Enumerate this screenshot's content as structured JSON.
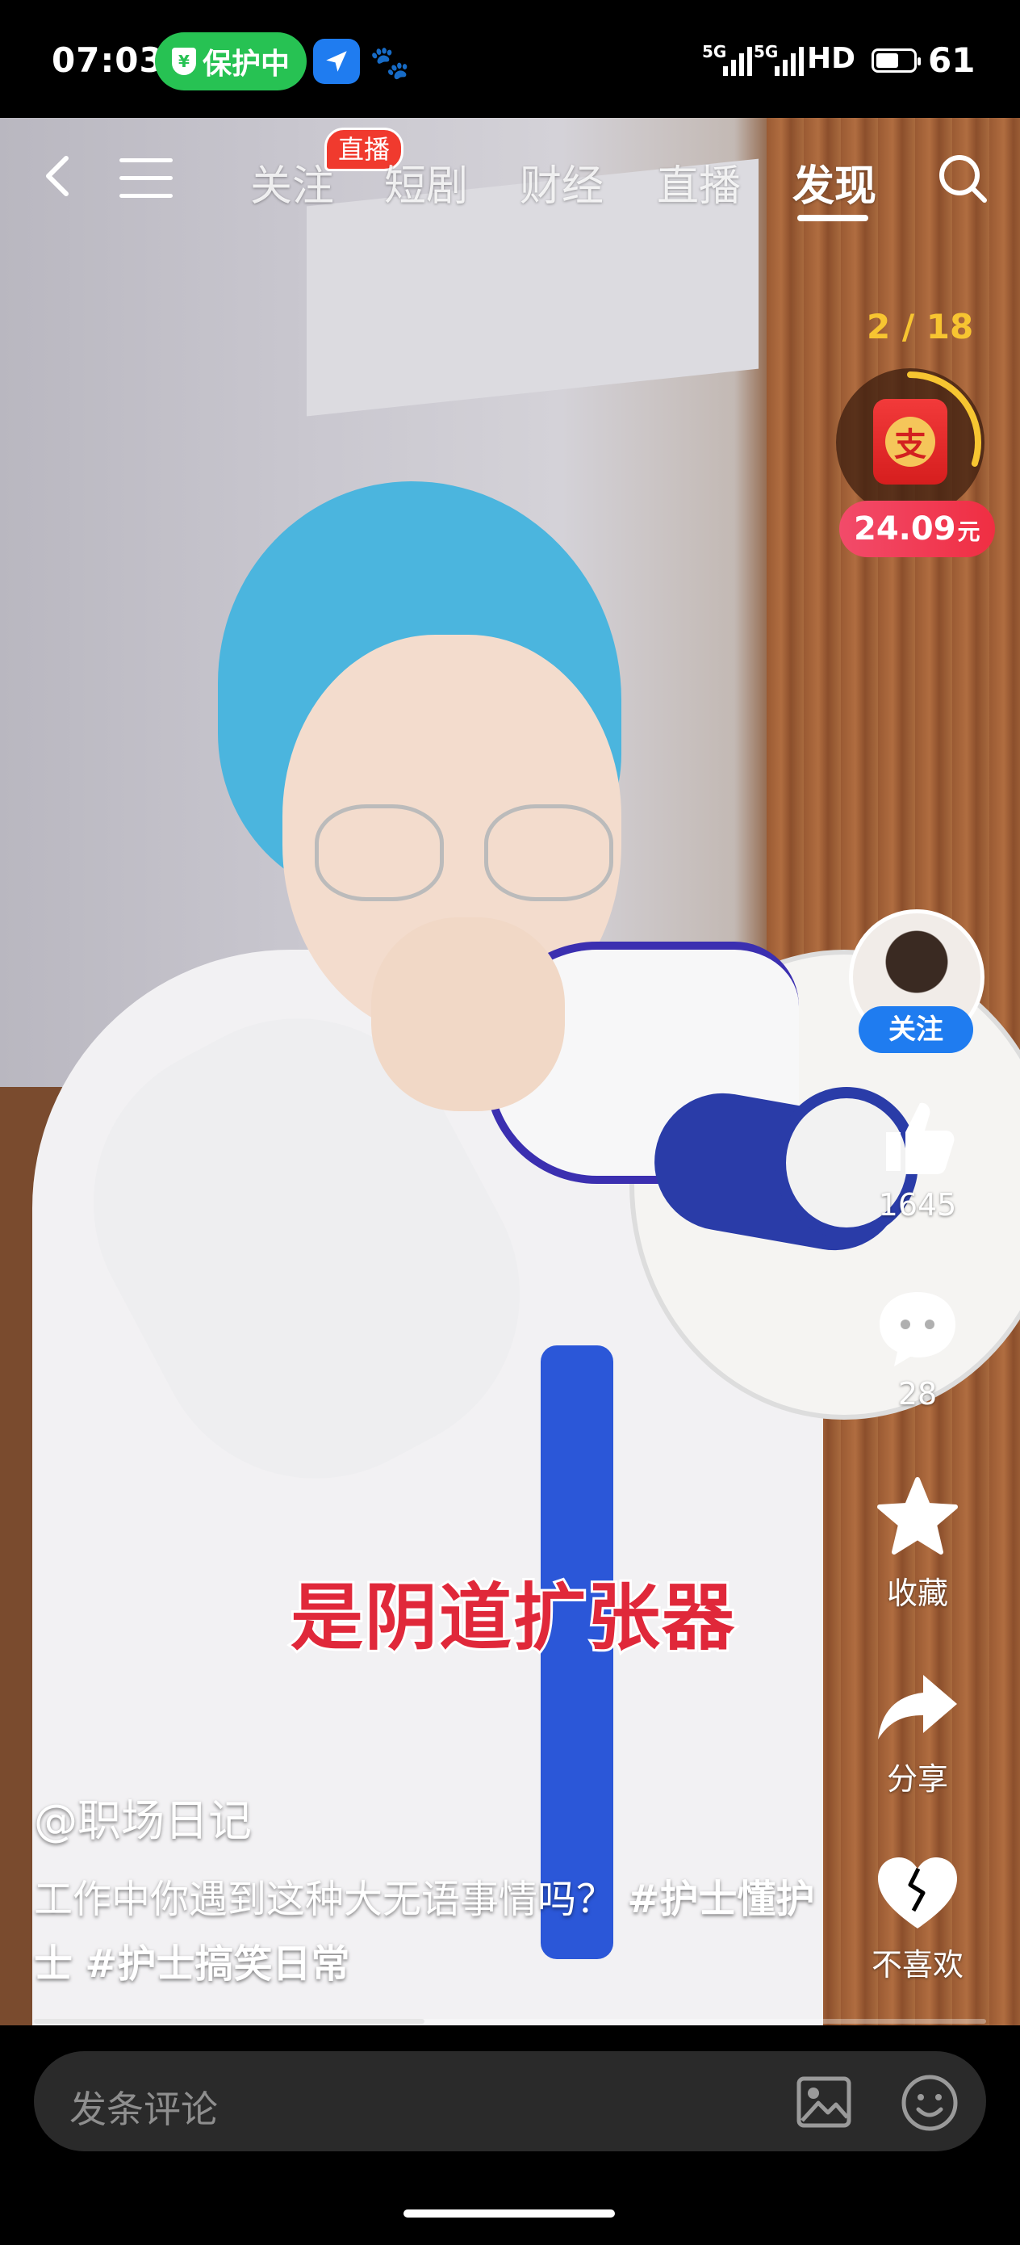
{
  "status_bar": {
    "time": "07:03",
    "protect_label": "保护中",
    "network": "5G",
    "hd": "HD",
    "battery": "61",
    "battery_level": 0.61
  },
  "nav": {
    "tabs": [
      {
        "label": "关注",
        "active": false
      },
      {
        "label": "短剧",
        "active": false
      },
      {
        "label": "财经",
        "active": false
      },
      {
        "label": "直播",
        "active": false
      },
      {
        "label": "发现",
        "active": true
      }
    ],
    "live_badge": "直播"
  },
  "reward": {
    "count": "2 / 18",
    "icon_char": "支",
    "amount": "24.09",
    "unit": "元",
    "progress": 0.3
  },
  "creator": {
    "follow_label": "关注"
  },
  "actions": {
    "like_count": "1645",
    "comment_count": "28",
    "favorite_label": "收藏",
    "share_label": "分享",
    "dislike_label": "不喜欢"
  },
  "video": {
    "subtitle": "是阴道扩张器",
    "author": "@职场日记",
    "desc_text": "工作中你遇到这种大无语事情吗？",
    "tag1": "#护士懂护士",
    "tag2": "#护士搞笑日常",
    "progress": 0.41
  },
  "comment": {
    "placeholder": "发条评论"
  }
}
